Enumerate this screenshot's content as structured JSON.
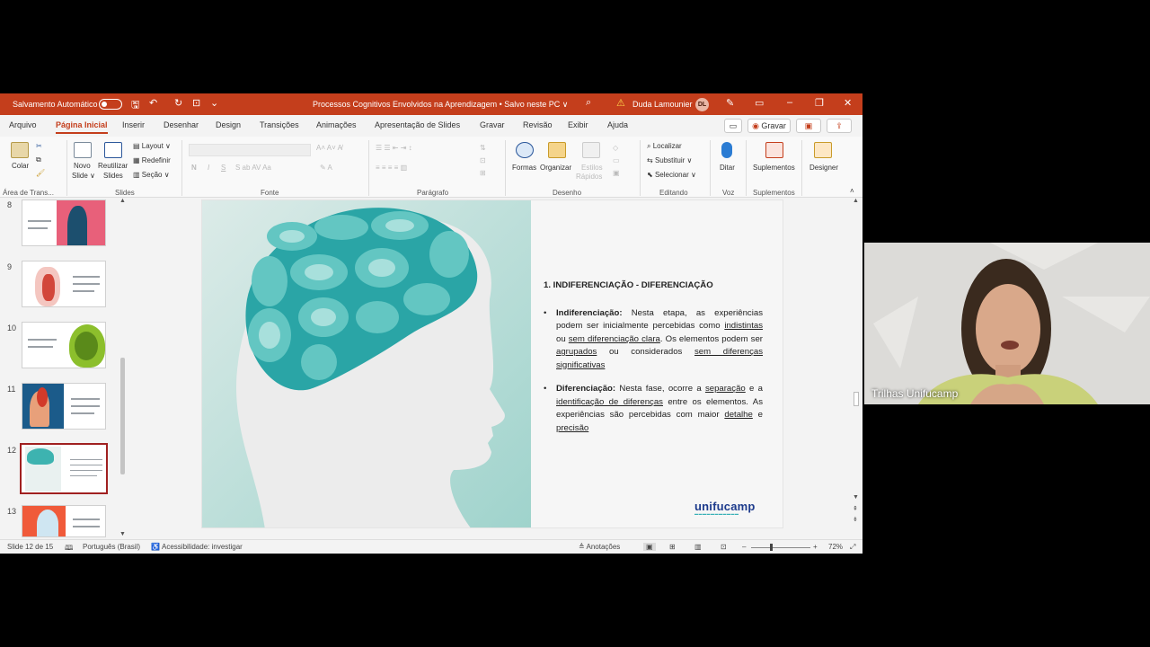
{
  "titlebar": {
    "autosave": "Salvamento Automático",
    "doc_title": "Processos Cognitivos Envolvidos na Aprendizagem • Salvo neste PC ∨",
    "user": "Duda Lamounier",
    "initials": "DL"
  },
  "menu": {
    "items": [
      "Arquivo",
      "Página Inicial",
      "Inserir",
      "Desenhar",
      "Design",
      "Transições",
      "Animações",
      "Apresentação de Slides",
      "Gravar",
      "Revisão",
      "Exibir",
      "Ajuda"
    ],
    "record": "Gravar"
  },
  "ribbon": {
    "colar": "Colar",
    "area": "Área de Trans...",
    "novo_slide": "Novo",
    "novo_slide2": "Slide ∨",
    "reutilizar": "Reutilizar",
    "reutilizar2": "Slides",
    "layout": "Layout ∨",
    "redefinir": "Redefinir",
    "secao": "Seção ∨",
    "slides_group": "Slides",
    "fonte_group": "Fonte",
    "paragrafo_group": "Parágrafo",
    "formas": "Formas",
    "organizar": "Organizar",
    "estilos": "Estilos",
    "estilos2": "Rápidos",
    "desenho_group": "Desenho",
    "localizar": "Localizar",
    "substituir": "Substituir ∨",
    "selecionar": "Selecionar ∨",
    "editando_group": "Editando",
    "ditar": "Ditar",
    "voz_group": "Voz",
    "suplementos": "Suplementos",
    "suplementos_group": "Suplementos",
    "designer": "Designer"
  },
  "thumbnails": [
    "8",
    "9",
    "10",
    "11",
    "12",
    "13"
  ],
  "slide": {
    "title": "1. INDIFERENCIAÇÃO - DIFERENCIAÇÃO",
    "b1_label": "Indiferenciação:",
    "b1_t1": " Nesta etapa, as experiências podem ser inicialmente percebidas como ",
    "b1_u1": "indistintas",
    "b1_t2": " ou ",
    "b1_u2": "sem diferenciação clara",
    "b1_t3": ". Os elementos podem ser ",
    "b1_u3": "agrupados",
    "b1_t4": " ou considerados ",
    "b1_u4": "sem diferenças significativas",
    "b2_label": "Diferenciação:",
    "b2_t1": " Nesta fase, ocorre a ",
    "b2_u1": "separação",
    "b2_t2": " e a ",
    "b2_u2": "identificação de diferenças",
    "b2_t3": " entre os elementos. As experiências são percebidas com maior ",
    "b2_u3": "detalhe",
    "b2_t4": " e ",
    "b2_u4": "precisão",
    "logo": "unifucamp"
  },
  "status": {
    "slide_count": "Slide 12 de 15",
    "language": "Português (Brasil)",
    "accessibility": "Acessibilidade: investigar",
    "notes": "Anotações",
    "zoom": "72%"
  },
  "video": {
    "name": "Trilhas Unifucamp"
  }
}
